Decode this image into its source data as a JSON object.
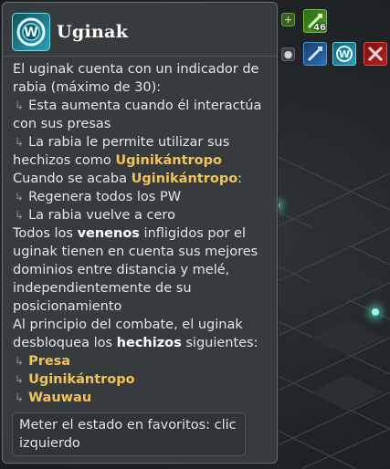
{
  "buffs": {
    "count": "46",
    "icons": [
      "plus-icon",
      "sword-green-icon",
      "circle-icon",
      "sword-blue-icon",
      "wauwau-icon",
      "cross-swords-icon"
    ]
  },
  "tooltip": {
    "title": "Uginak",
    "lines": [
      {
        "type": "text",
        "text": "El uginak cuenta con un indicador de"
      },
      {
        "type": "text",
        "text": "rabia (máximo de 30):"
      },
      {
        "type": "sub",
        "text": "Esta aumenta cuando él interactúa"
      },
      {
        "type": "text",
        "text": "con sus presas"
      },
      {
        "type": "sub",
        "text": "La rabia le permite utilizar sus"
      },
      {
        "type": "mix",
        "pre": "hechizos como ",
        "hl": "Uginikántropo",
        "post": ""
      },
      {
        "type": "mix",
        "pre": "Cuando se acaba ",
        "hl": "Uginikántropo",
        "post": ":"
      },
      {
        "type": "sub",
        "text": "Regenera todos los PW"
      },
      {
        "type": "sub",
        "text": "La rabia vuelve a cero"
      },
      {
        "type": "mixb",
        "pre": "Todos los ",
        "hl": "venenos",
        "post": " infligidos por el"
      },
      {
        "type": "text",
        "text": "uginak tienen en cuenta sus mejores"
      },
      {
        "type": "text",
        "text": "dominios entre distancia y melé,"
      },
      {
        "type": "text",
        "text": "independientemente de su"
      },
      {
        "type": "text",
        "text": "posicionamiento"
      },
      {
        "type": "text",
        "text": "Al principio del combate, el uginak"
      },
      {
        "type": "mixb",
        "pre": "desbloquea los ",
        "hl": "hechizos",
        "post": " siguientes:"
      },
      {
        "type": "spell",
        "text": "Presa"
      },
      {
        "type": "spell",
        "text": "Uginikántropo"
      },
      {
        "type": "spell",
        "text": "Wauwau"
      }
    ],
    "footer": "Meter el estado en favoritos: clic izquierdo"
  },
  "colors": {
    "highlight": "#f1c35a",
    "panel": "#383c3e",
    "accent": "#2aa0b5"
  }
}
